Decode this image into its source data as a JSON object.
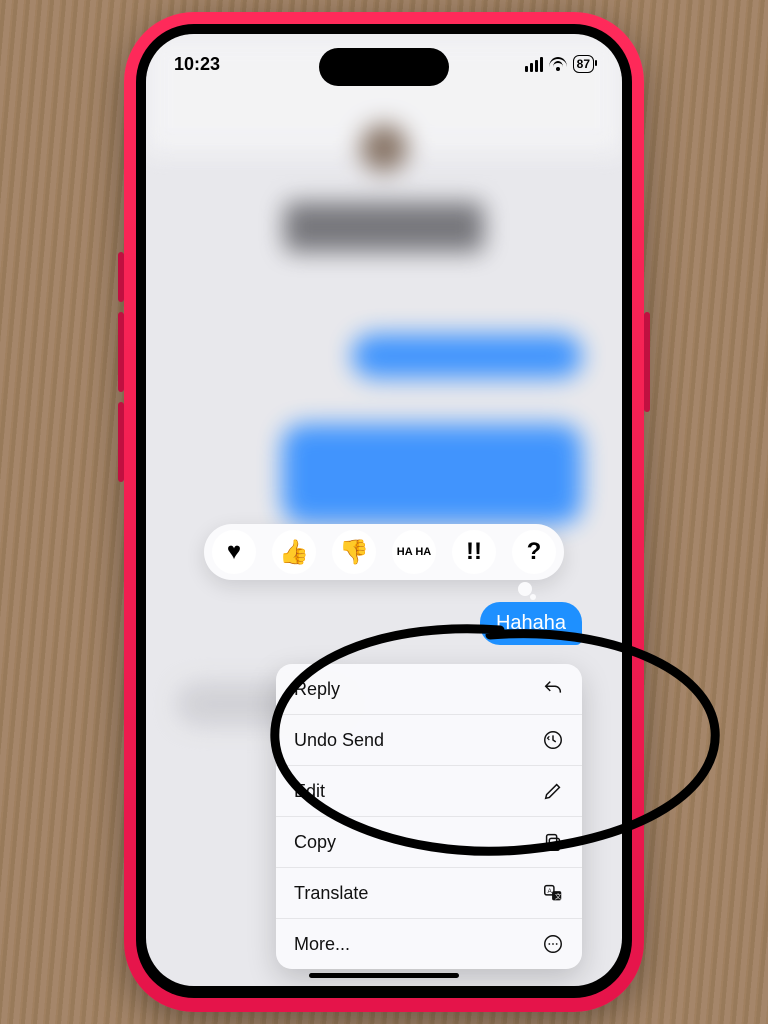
{
  "status": {
    "time": "10:23",
    "battery": "87"
  },
  "bubble_text": "Hahaha",
  "tapbacks": {
    "heart": "♥",
    "thumbs_up": "👍",
    "thumbs_down": "👎",
    "haha": "HA HA",
    "exclaim": "!!",
    "question": "?"
  },
  "menu": {
    "reply": "Reply",
    "undo_send": "Undo Send",
    "edit": "Edit",
    "copy": "Copy",
    "translate": "Translate",
    "more": "More..."
  }
}
